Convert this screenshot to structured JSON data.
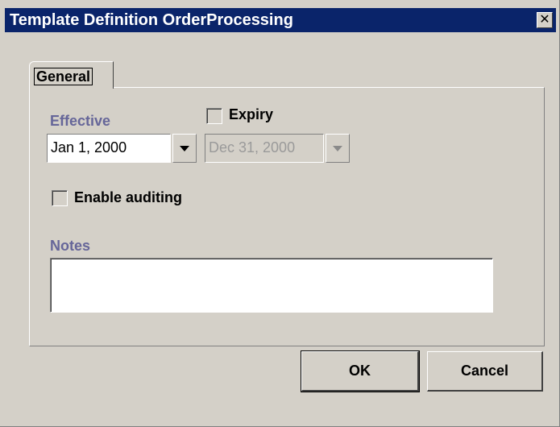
{
  "window": {
    "title": "Template Definition OrderProcessing",
    "close_glyph": "✕"
  },
  "tabs": [
    {
      "label": "General",
      "active": true
    }
  ],
  "general": {
    "effective_label": "Effective",
    "effective_value": "Jan 1, 2000",
    "expiry_label": "Expiry",
    "expiry_checked": false,
    "expiry_value": "Dec 31, 2000",
    "auditing_label": "Enable auditing",
    "auditing_checked": false,
    "notes_label": "Notes",
    "notes_value": ""
  },
  "buttons": {
    "ok_label": "OK",
    "cancel_label": "Cancel"
  },
  "colors": {
    "titlebar": "#0a246a",
    "dialog_bg": "#d4d0c8",
    "label_accent": "#666699",
    "disabled_text": "#9a9a9a"
  },
  "icons": {
    "close": "close-icon",
    "dropdown": "chevron-down-icon"
  }
}
